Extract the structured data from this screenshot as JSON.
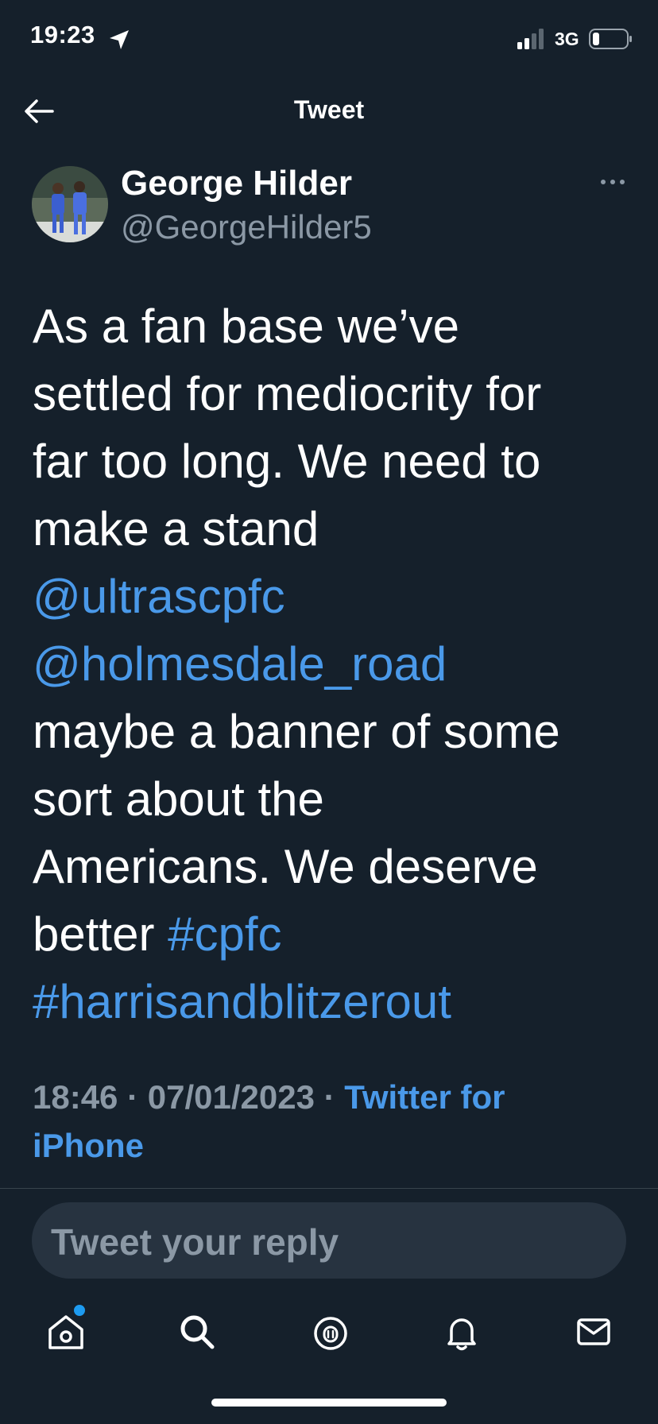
{
  "status_bar": {
    "time": "19:23",
    "network": "3G",
    "icons": [
      "location-arrow-icon",
      "signal-bars-icon",
      "battery-icon"
    ]
  },
  "header": {
    "title": "Tweet",
    "back_icon": "arrow-left-icon"
  },
  "tweet": {
    "author": {
      "name": "George Hilder",
      "handle": "@GeorgeHilder5"
    },
    "more_icon": "ellipsis-icon",
    "lines": {
      "l1": "As a fan base we’ve",
      "l2": "settled for mediocrity for",
      "l3": "far too long. We need to",
      "l4": "make a stand",
      "mention1": "@ultrascpfc",
      "mention2": "@holmesdale_road",
      "l7": "maybe a banner of some",
      "l8": "sort about the",
      "l9": "Americans. We deserve",
      "l10_text": "better ",
      "hashtag1": "#cpfc",
      "hashtag2": "#harrisandblitzerout"
    },
    "meta": {
      "time": "18:46",
      "separator": " · ",
      "date": "07/01/2023",
      "source_line1": "Twitter for",
      "source_line2": "iPhone"
    }
  },
  "reply": {
    "placeholder": "Tweet your reply"
  },
  "tab_bar": {
    "items": [
      "home-icon",
      "search-icon",
      "spaces-icon",
      "notifications-icon",
      "messages-icon"
    ],
    "home_has_notification_dot": true
  },
  "colors": {
    "background": "#15202b",
    "link": "#4a99e9",
    "secondary_text": "#8b98a5",
    "reply_box": "#273340",
    "divider": "#38444d"
  }
}
